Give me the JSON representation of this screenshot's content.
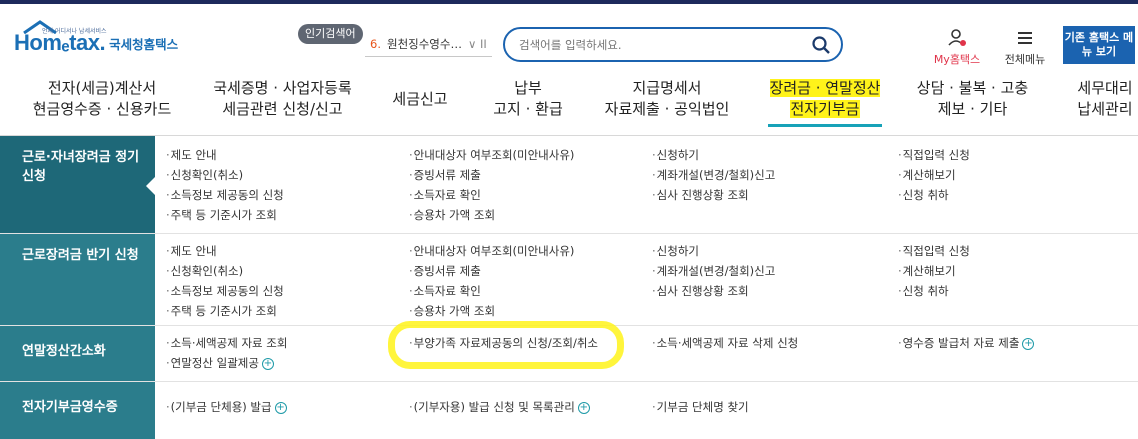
{
  "logo": {
    "main": "Homₑtax.",
    "sub": "국세청홈택스",
    "tiny": "언제 어디서나 납세서비스"
  },
  "popular": {
    "badge": "인기검색어",
    "rank": "6.",
    "term": "원천징수영수…",
    "controls": "∨ II"
  },
  "search": {
    "placeholder": "검색어를 입력하세요."
  },
  "utility": {
    "my": "My홈택스",
    "all_menu": "전체메뉴",
    "legacy": "기존 홈택스 메뉴 보기"
  },
  "gnb": [
    {
      "line1": "전자(세금)계산서",
      "line2": "현금영수증 · 신용카드"
    },
    {
      "line1": "국세증명 · 사업자등록",
      "line2": "세금관련 신청/신고"
    },
    {
      "line1": "세금신고",
      "line2": ""
    },
    {
      "line1": "납부",
      "line2": "고지 · 환급"
    },
    {
      "line1": "지급명세서",
      "line2": "자료제출 · 공익법인"
    },
    {
      "line1": "장려금 · 연말정산",
      "line2": "전자기부금"
    },
    {
      "line1": "상담 · 불복 · 고충",
      "line2": "제보 · 기타"
    },
    {
      "line1": "세무대리",
      "line2": "납세관리"
    }
  ],
  "rows": [
    {
      "title1": "근로·자녀장려금 정기",
      "title2": "신청",
      "cols": [
        [
          "제도 안내",
          "신청확인(취소)",
          "소득정보 제공동의 신청",
          "주택 등 기준시가 조회"
        ],
        [
          "안내대상자 여부조회(미안내사유)",
          "증빙서류 제출",
          "소득자료 확인",
          "승용차 가액 조회"
        ],
        [
          "신청하기",
          "계좌개설(변경/철회)신고",
          "심사 진행상황 조회"
        ],
        [
          "직접입력 신청",
          "계산해보기",
          "신청 취하"
        ]
      ]
    },
    {
      "title1": "근로장려금 반기 신청",
      "title2": "",
      "cols": [
        [
          "제도 안내",
          "신청확인(취소)",
          "소득정보 제공동의 신청",
          "주택 등 기준시가 조회"
        ],
        [
          "안내대상자 여부조회(미안내사유)",
          "증빙서류 제출",
          "소득자료 확인",
          "승용차 가액 조회"
        ],
        [
          "신청하기",
          "계좌개설(변경/철회)신고",
          "심사 진행상황 조회"
        ],
        [
          "직접입력 신청",
          "계산해보기",
          "신청 취하"
        ]
      ]
    },
    {
      "title1": "연말정산간소화",
      "title2": "",
      "cols": [
        [
          "소득·세액공제 자료 조회",
          "연말정산 일괄제공"
        ],
        [
          "부양가족 자료제공동의 신청/조회/취소"
        ],
        [
          "소득·세액공제 자료 삭제 신청"
        ],
        [
          "영수증 발급처 자료 제출"
        ]
      ]
    },
    {
      "title1": "전자기부금영수증",
      "title2": "",
      "cols": [
        [
          "(기부금 단체용) 발급"
        ],
        [
          "(기부자용) 발급 신청 및 목록관리"
        ],
        [
          "기부금 단체명 찾기"
        ],
        []
      ]
    }
  ],
  "colors": {
    "primary": "#1b63b0",
    "teal_head": "#2b7d8c",
    "highlight": "#fff31a",
    "pop_rank": "#e8541a"
  }
}
